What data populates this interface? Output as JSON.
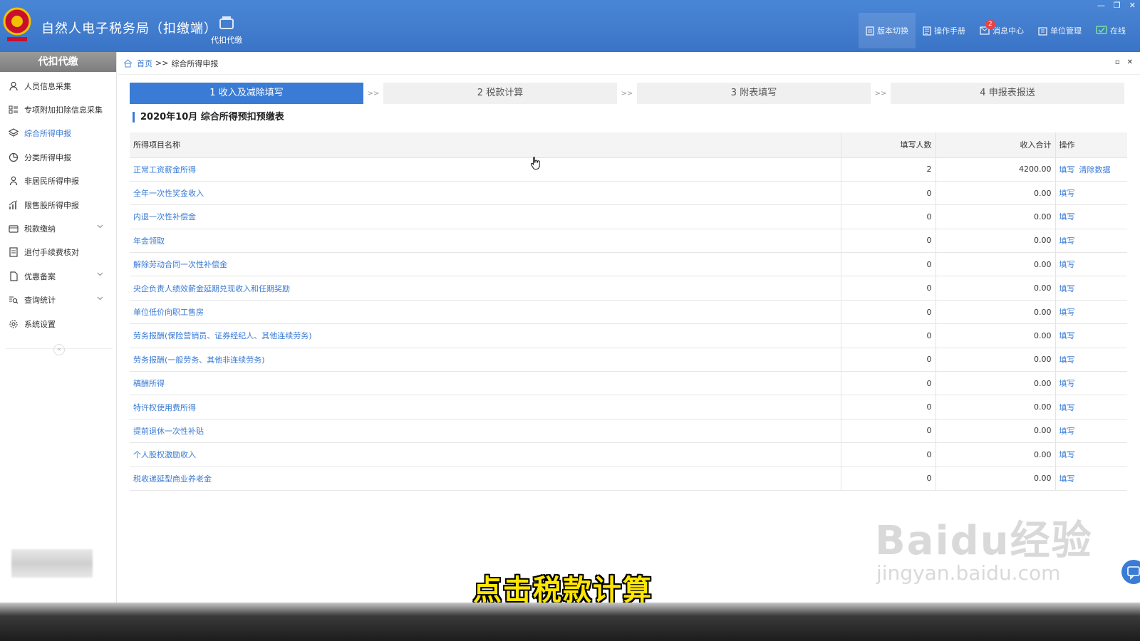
{
  "app": {
    "title": "自然人电子税务局（扣缴端）",
    "module_label": "代扣代缴",
    "window_controls": [
      "—",
      "❐",
      "✕"
    ]
  },
  "top_actions": [
    {
      "label": "版本切换",
      "icon": "version-switch-icon"
    },
    {
      "label": "操作手册",
      "icon": "manual-icon"
    },
    {
      "label": "消息中心",
      "icon": "message-icon",
      "badge": "2"
    },
    {
      "label": "单位管理",
      "icon": "unit-manage-icon"
    },
    {
      "label": "在线",
      "icon": "online-icon"
    }
  ],
  "sidebar": {
    "header": "代扣代缴",
    "collapse_glyph": "«",
    "items": [
      {
        "label": "人员信息采集",
        "icon": "person-icon"
      },
      {
        "label": "专项附加扣除信息采集",
        "icon": "grid-list-icon"
      },
      {
        "label": "综合所得申报",
        "icon": "layers-icon",
        "active": true
      },
      {
        "label": "分类所得申报",
        "icon": "pie-chart-icon"
      },
      {
        "label": "非居民所得申报",
        "icon": "person-outline-icon"
      },
      {
        "label": "限售股所得申报",
        "icon": "bar-chart-icon"
      },
      {
        "label": "税款缴纳",
        "icon": "wallet-icon",
        "expandable": true
      },
      {
        "label": "退付手续费核对",
        "icon": "document-check-icon"
      },
      {
        "label": "优惠备案",
        "icon": "file-icon",
        "expandable": true
      },
      {
        "label": "查询统计",
        "icon": "search-list-icon",
        "expandable": true
      },
      {
        "label": "系统设置",
        "icon": "gear-icon"
      }
    ]
  },
  "breadcrumb": {
    "home": "首页",
    "separator": ">>",
    "current": "综合所得申报"
  },
  "panel_controls": [
    "▫",
    "✕"
  ],
  "steps": {
    "separator": ">>",
    "items": [
      {
        "label": "1 收入及减除填写",
        "active": true
      },
      {
        "label": "2 税款计算",
        "active": false
      },
      {
        "label": "3 附表填写",
        "active": false
      },
      {
        "label": "4 申报表报送",
        "active": false
      }
    ]
  },
  "section_title": "2020年10月  综合所得预扣预缴表",
  "table": {
    "headers": {
      "name": "所得项目名称",
      "count": "填写人数",
      "income": "收入合计",
      "ops": "操作"
    },
    "rows": [
      {
        "name": "正常工资薪金所得",
        "count": "2",
        "income": "4200.00",
        "ops": [
          "填写",
          "清除数据"
        ]
      },
      {
        "name": "全年一次性奖金收入",
        "count": "0",
        "income": "0.00",
        "ops": [
          "填写"
        ]
      },
      {
        "name": "内退一次性补偿金",
        "count": "0",
        "income": "0.00",
        "ops": [
          "填写"
        ]
      },
      {
        "name": "年金领取",
        "count": "0",
        "income": "0.00",
        "ops": [
          "填写"
        ]
      },
      {
        "name": "解除劳动合同一次性补偿金",
        "count": "0",
        "income": "0.00",
        "ops": [
          "填写"
        ]
      },
      {
        "name": "央企负责人绩效薪金延期兑现收入和任期奖励",
        "count": "0",
        "income": "0.00",
        "ops": [
          "填写"
        ]
      },
      {
        "name": "单位低价向职工售房",
        "count": "0",
        "income": "0.00",
        "ops": [
          "填写"
        ]
      },
      {
        "name": "劳务报酬(保险营销员、证券经纪人、其他连续劳务)",
        "count": "0",
        "income": "0.00",
        "ops": [
          "填写"
        ]
      },
      {
        "name": "劳务报酬(一般劳务、其他非连续劳务)",
        "count": "0",
        "income": "0.00",
        "ops": [
          "填写"
        ]
      },
      {
        "name": "稿酬所得",
        "count": "0",
        "income": "0.00",
        "ops": [
          "填写"
        ]
      },
      {
        "name": "特许权使用费所得",
        "count": "0",
        "income": "0.00",
        "ops": [
          "填写"
        ]
      },
      {
        "name": "提前退休一次性补贴",
        "count": "0",
        "income": "0.00",
        "ops": [
          "填写"
        ]
      },
      {
        "name": "个人股权激励收入",
        "count": "0",
        "income": "0.00",
        "ops": [
          "填写"
        ]
      },
      {
        "name": "税收递延型商业养老金",
        "count": "0",
        "income": "0.00",
        "ops": [
          "填写"
        ]
      }
    ]
  },
  "overlay": {
    "subtitle": "点击税款计算",
    "watermark_main": "Baidu经验",
    "watermark_sub": "jingyan.baidu.com"
  },
  "colors": {
    "header_blue": "#3a74c6",
    "accent_blue": "#3a7bd5",
    "subtitle_yellow": "#ffe600"
  }
}
